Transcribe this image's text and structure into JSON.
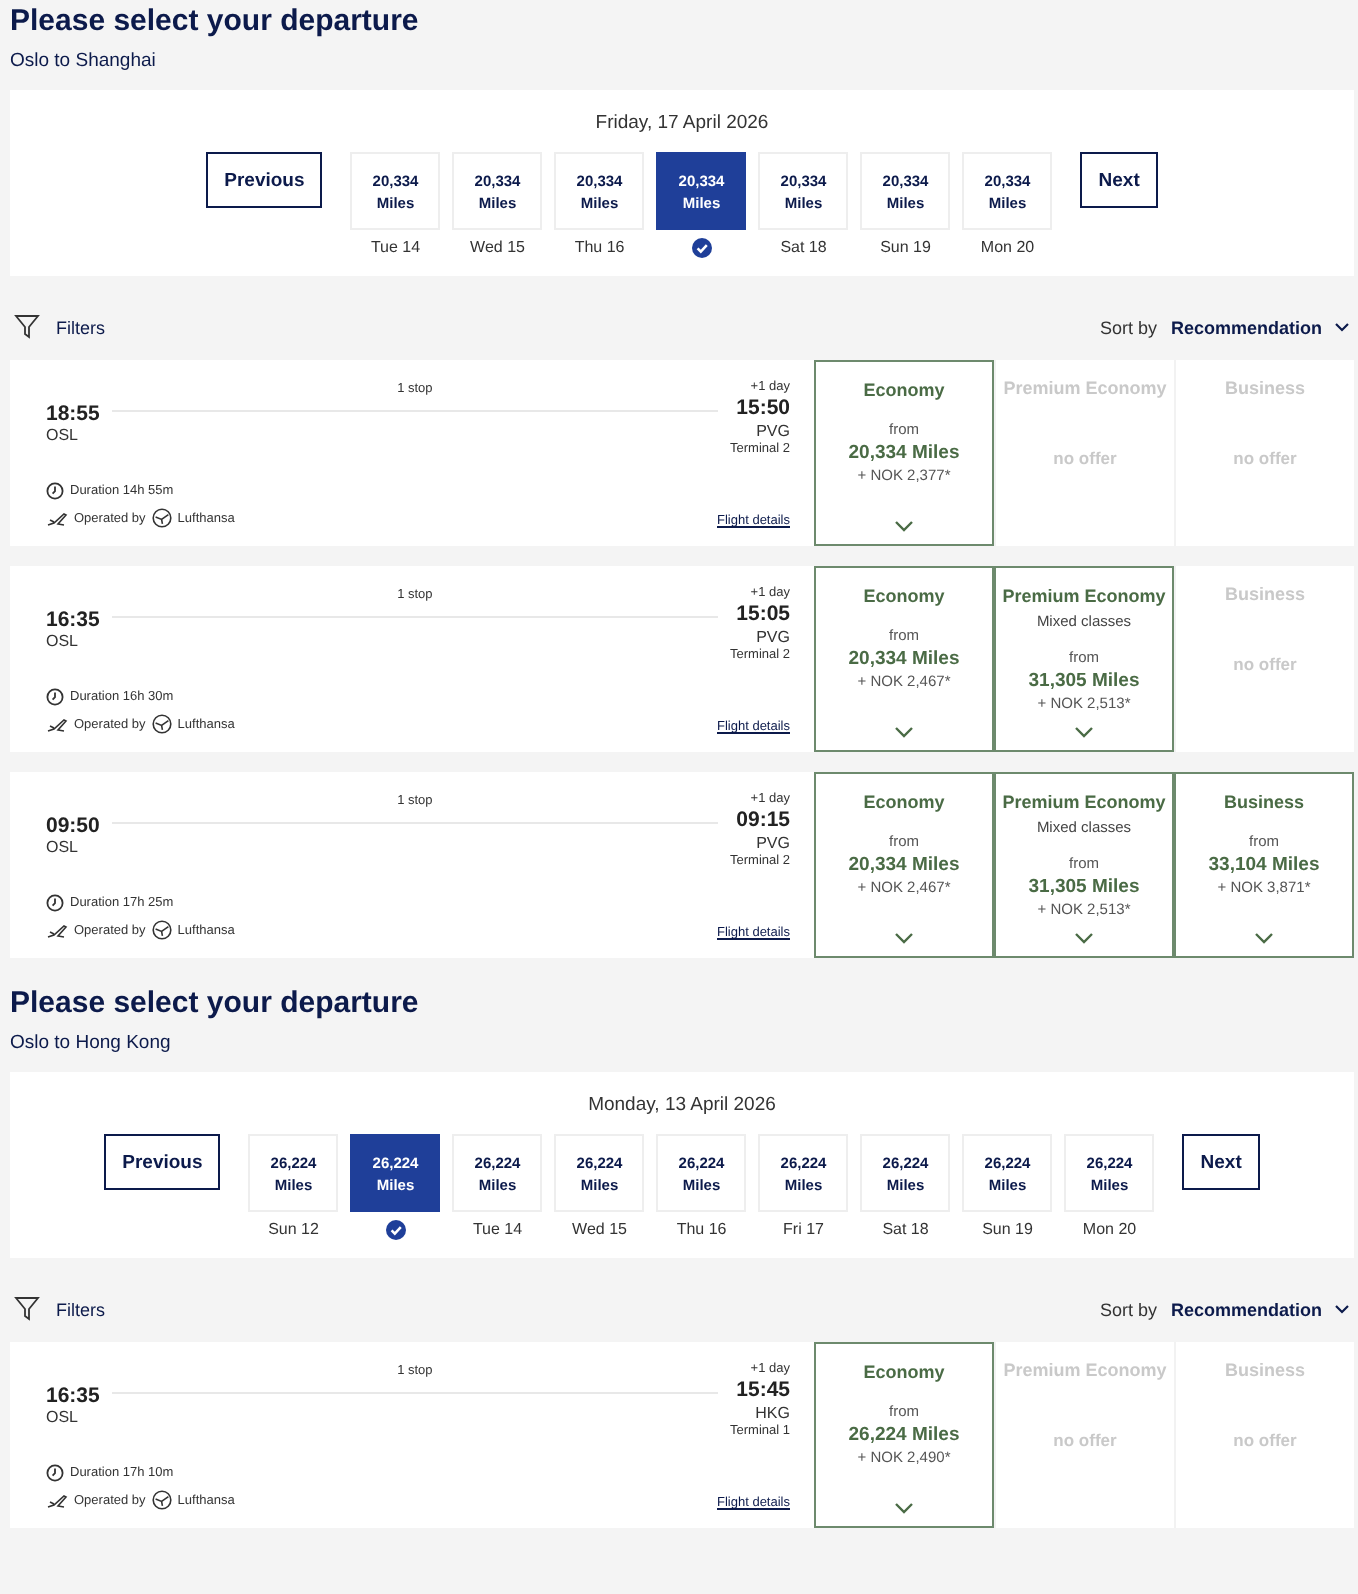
{
  "sections": [
    {
      "title": "Please select your departure",
      "route": "Oslo to Shanghai",
      "date": "Friday, 17 April 2026",
      "previous": "Previous",
      "next": "Next",
      "days": [
        {
          "miles": "20,334",
          "unit": "Miles",
          "label": "Tue 14",
          "selected": false
        },
        {
          "miles": "20,334",
          "unit": "Miles",
          "label": "Wed 15",
          "selected": false
        },
        {
          "miles": "20,334",
          "unit": "Miles",
          "label": "Thu 16",
          "selected": false
        },
        {
          "miles": "20,334",
          "unit": "Miles",
          "selected": true
        },
        {
          "miles": "20,334",
          "unit": "Miles",
          "label": "Sat 18",
          "selected": false
        },
        {
          "miles": "20,334",
          "unit": "Miles",
          "label": "Sun 19",
          "selected": false
        },
        {
          "miles": "20,334",
          "unit": "Miles",
          "label": "Mon 20",
          "selected": false
        }
      ],
      "filters": "Filters",
      "sort_label": "Sort by",
      "sort_value": "Recommendation",
      "flights": [
        {
          "departure_time": "18:55",
          "departure_airport": "OSL",
          "stops": "1 stop",
          "day_offset": "+1 day",
          "arrival_time": "15:50",
          "arrival_airport": "PVG",
          "terminal": "Terminal 2",
          "duration": "Duration 14h 55m",
          "operated_by": "Operated by",
          "airline": "Lufthansa",
          "details_link": "Flight details",
          "fares": [
            {
              "kind": "offer",
              "cabin": "Economy",
              "from": "from",
              "miles": "20,334 Miles",
              "surcharge": "+ NOK 2,377*"
            },
            {
              "kind": "none",
              "cabin": "Premium Economy",
              "note": "no offer"
            },
            {
              "kind": "none",
              "cabin": "Business",
              "note": "no offer"
            }
          ]
        },
        {
          "departure_time": "16:35",
          "departure_airport": "OSL",
          "stops": "1 stop",
          "day_offset": "+1 day",
          "arrival_time": "15:05",
          "arrival_airport": "PVG",
          "terminal": "Terminal 2",
          "duration": "Duration 16h 30m",
          "operated_by": "Operated by",
          "airline": "Lufthansa",
          "details_link": "Flight details",
          "fares": [
            {
              "kind": "offer",
              "cabin": "Economy",
              "from": "from",
              "miles": "20,334 Miles",
              "surcharge": "+ NOK 2,467*"
            },
            {
              "kind": "offer",
              "cabin": "Premium Economy",
              "detail": "Mixed classes",
              "from": "from",
              "miles": "31,305 Miles",
              "surcharge": "+ NOK 2,513*"
            },
            {
              "kind": "none",
              "cabin": "Business",
              "note": "no offer"
            }
          ]
        },
        {
          "departure_time": "09:50",
          "departure_airport": "OSL",
          "stops": "1 stop",
          "day_offset": "+1 day",
          "arrival_time": "09:15",
          "arrival_airport": "PVG",
          "terminal": "Terminal 2",
          "duration": "Duration 17h 25m",
          "operated_by": "Operated by",
          "airline": "Lufthansa",
          "details_link": "Flight details",
          "fares": [
            {
              "kind": "offer",
              "cabin": "Economy",
              "from": "from",
              "miles": "20,334 Miles",
              "surcharge": "+ NOK 2,467*"
            },
            {
              "kind": "offer",
              "cabin": "Premium Economy",
              "detail": "Mixed classes",
              "from": "from",
              "miles": "31,305 Miles",
              "surcharge": "+ NOK 2,513*"
            },
            {
              "kind": "offer",
              "cabin": "Business",
              "from": "from",
              "miles": "33,104 Miles",
              "surcharge": "+ NOK 3,871*"
            }
          ]
        }
      ]
    },
    {
      "title": "Please select your departure",
      "route": "Oslo to Hong Kong",
      "date": "Monday, 13 April 2026",
      "previous": "Previous",
      "next": "Next",
      "days": [
        {
          "miles": "26,224",
          "unit": "Miles",
          "label": "Sun 12",
          "selected": false
        },
        {
          "miles": "26,224",
          "unit": "Miles",
          "selected": true
        },
        {
          "miles": "26,224",
          "unit": "Miles",
          "label": "Tue 14",
          "selected": false
        },
        {
          "miles": "26,224",
          "unit": "Miles",
          "label": "Wed 15",
          "selected": false
        },
        {
          "miles": "26,224",
          "unit": "Miles",
          "label": "Thu 16",
          "selected": false
        },
        {
          "miles": "26,224",
          "unit": "Miles",
          "label": "Fri 17",
          "selected": false
        },
        {
          "miles": "26,224",
          "unit": "Miles",
          "label": "Sat 18",
          "selected": false
        },
        {
          "miles": "26,224",
          "unit": "Miles",
          "label": "Sun 19",
          "selected": false
        },
        {
          "miles": "26,224",
          "unit": "Miles",
          "label": "Mon 20",
          "selected": false
        }
      ],
      "filters": "Filters",
      "sort_label": "Sort by",
      "sort_value": "Recommendation",
      "flights": [
        {
          "departure_time": "16:35",
          "departure_airport": "OSL",
          "stops": "1 stop",
          "day_offset": "+1 day",
          "arrival_time": "15:45",
          "arrival_airport": "HKG",
          "terminal": "Terminal 1",
          "duration": "Duration 17h 10m",
          "operated_by": "Operated by",
          "airline": "Lufthansa",
          "details_link": "Flight details",
          "fares": [
            {
              "kind": "offer",
              "cabin": "Economy",
              "from": "from",
              "miles": "26,224 Miles",
              "surcharge": "+ NOK 2,490*"
            },
            {
              "kind": "none",
              "cabin": "Premium Economy",
              "note": "no offer"
            },
            {
              "kind": "none",
              "cabin": "Business",
              "note": "no offer"
            }
          ]
        }
      ]
    }
  ]
}
